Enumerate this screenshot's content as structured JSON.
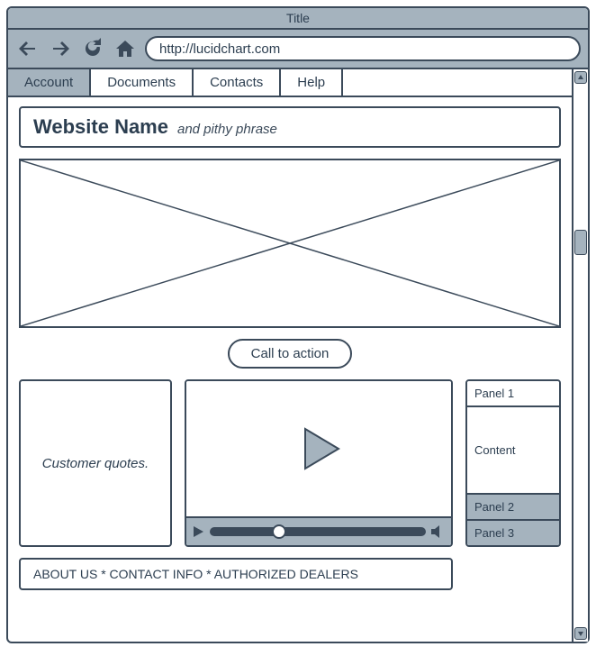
{
  "window": {
    "title": "Title"
  },
  "browser": {
    "url": "http://lucidchart.com"
  },
  "tabs": [
    {
      "label": "Account",
      "active": true
    },
    {
      "label": "Documents",
      "active": false
    },
    {
      "label": "Contacts",
      "active": false
    },
    {
      "label": "Help",
      "active": false
    }
  ],
  "site": {
    "name": "Website Name",
    "tagline": "and pithy phrase"
  },
  "cta": {
    "label": "Call to action"
  },
  "quotes": {
    "text": "Customer quotes."
  },
  "accordion": {
    "panel1": "Panel 1",
    "content": "Content",
    "panel2": "Panel 2",
    "panel3": "Panel 3"
  },
  "footer": {
    "text": "ABOUT US  * CONTACT INFO * AUTHORIZED DEALERS"
  }
}
